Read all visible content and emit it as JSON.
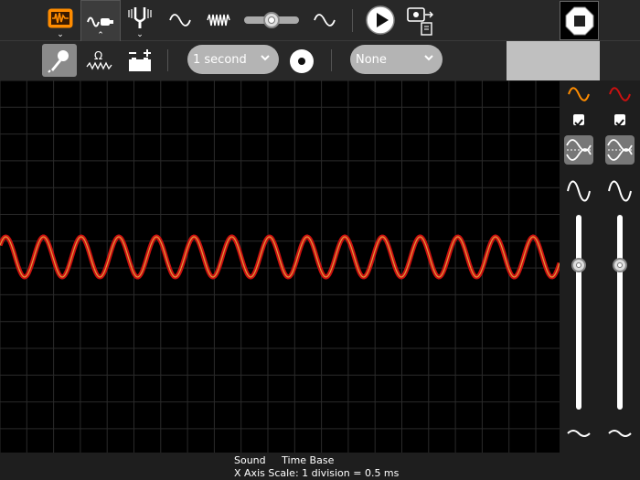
{
  "toolbar": {
    "interval_combo": "1 second",
    "trigger_combo": "None"
  },
  "status": {
    "mode": "Sound",
    "timebase": "Time Base",
    "scale_text": "X Axis Scale: 1 division = 0.5 ms"
  },
  "colors": {
    "accent_orange": "#ff8c00",
    "trace_red": "#cc1010",
    "trace_orange": "#e09a3a"
  },
  "icons": {
    "oscilloscope": "oscilloscope-icon",
    "sensor": "sensor-icon",
    "tuning_fork": "tuning-fork-icon",
    "sine": "sine-wave-icon",
    "square": "square-wave-icon",
    "play": "play-icon",
    "export": "export-icon",
    "stop": "stop-icon",
    "microphone": "microphone-icon",
    "resistance": "resistance-icon",
    "battery": "battery-icon",
    "record": "record-icon"
  },
  "right_panel": {
    "channel1_checked": true,
    "channel2_checked": true,
    "channel1_gain_level": 0.74,
    "channel2_gain_level": 0.74
  }
}
